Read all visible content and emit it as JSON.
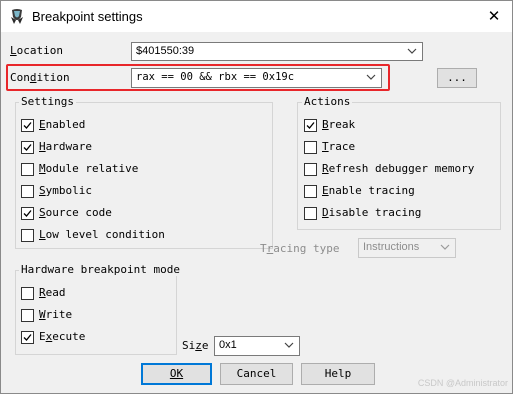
{
  "window": {
    "title": "Breakpoint settings",
    "app_icon": "x64dbg-icon",
    "close_icon": "close-icon"
  },
  "location": {
    "label": "Location",
    "value": "$401550:39"
  },
  "condition": {
    "label": "Condition",
    "value": "rax == 00 && rbx == 0x19c",
    "ellipsis_label": "...",
    "highlight_color": "#e8262a"
  },
  "settings": {
    "title": "Settings",
    "items": [
      {
        "label": "Enabled",
        "checked": true
      },
      {
        "label": "Hardware",
        "checked": true
      },
      {
        "label": "Module relative",
        "checked": false
      },
      {
        "label": "Symbolic",
        "checked": false
      },
      {
        "label": "Source code",
        "checked": true
      },
      {
        "label": "Low level condition",
        "checked": false
      }
    ]
  },
  "actions": {
    "title": "Actions",
    "items": [
      {
        "label": "Break",
        "checked": true
      },
      {
        "label": "Trace",
        "checked": false
      },
      {
        "label": "Refresh debugger memory",
        "checked": false
      },
      {
        "label": "Enable tracing",
        "checked": false
      },
      {
        "label": "Disable tracing",
        "checked": false
      }
    ]
  },
  "tracing_type": {
    "label": "Tracing type",
    "value": "Instructions",
    "enabled": false
  },
  "hw_mode": {
    "title": "Hardware breakpoint mode",
    "items": [
      {
        "label": "Read",
        "checked": false
      },
      {
        "label": "Write",
        "checked": false
      },
      {
        "label": "Execute",
        "checked": true
      }
    ]
  },
  "size": {
    "label": "Size",
    "value": "0x1"
  },
  "buttons": {
    "ok": "OK",
    "cancel": "Cancel",
    "help": "Help"
  },
  "watermark": "CSDN @Administrator",
  "colors": {
    "accent": "#0078d7",
    "highlight": "#e8262a"
  }
}
